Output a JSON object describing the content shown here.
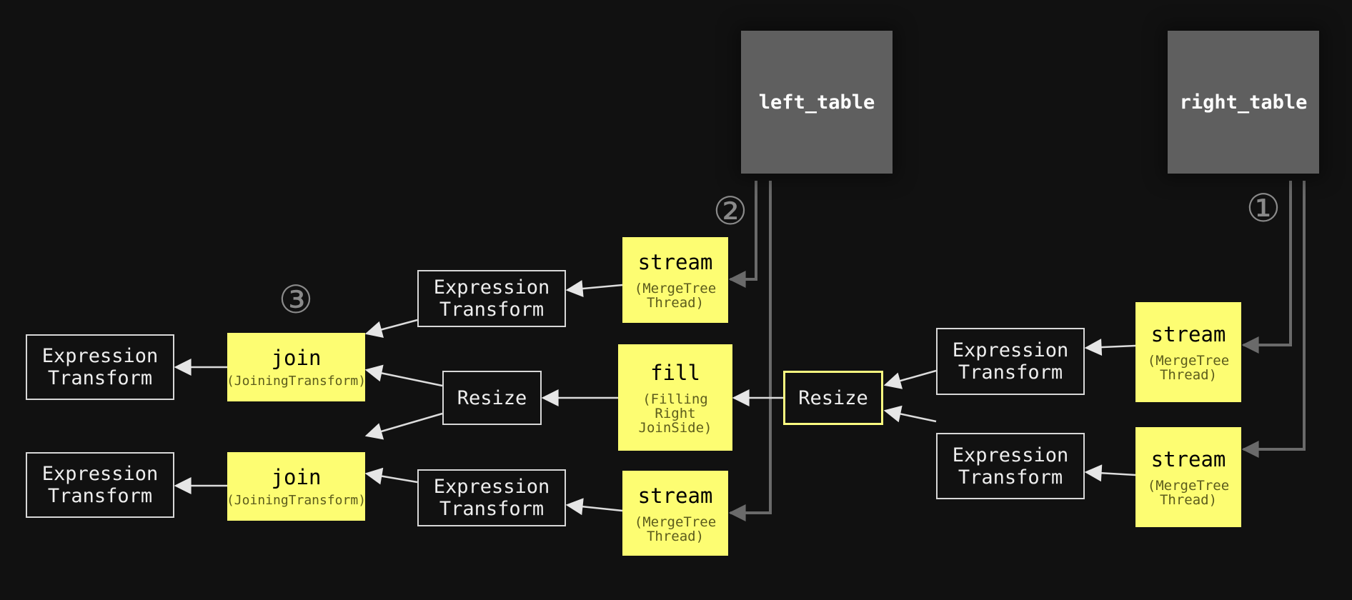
{
  "diagram": {
    "tables": {
      "left": "left_table",
      "right": "right_table"
    },
    "markers": {
      "one": "①",
      "two": "②",
      "three": "③"
    },
    "nodes": {
      "stream_title": "stream",
      "stream_sub": "(MergeTree\nThread)",
      "expression_label": "Expression\nTransform",
      "resize_label": "Resize",
      "fill_title": "fill",
      "fill_sub": "(Filling\nRight\nJoinSide)",
      "join_title": "join",
      "join_sub": "(JoiningTransform)"
    },
    "colors": {
      "background": "#111111",
      "table_fill": "#5f5f5f",
      "highlight_fill": "#fdfd72",
      "highlight_border": "#fcfc80",
      "edge": "#e0e0e0",
      "table_edge": "#6a6a6a"
    },
    "edges": [
      {
        "from": "right_table",
        "to": "right-stream-1"
      },
      {
        "from": "right_table",
        "to": "right-stream-2"
      },
      {
        "from": "right-stream-1",
        "to": "right-expression-1"
      },
      {
        "from": "right-stream-2",
        "to": "right-expression-2"
      },
      {
        "from": "right-expression-1",
        "to": "right-resize"
      },
      {
        "from": "right-expression-2",
        "to": "right-resize"
      },
      {
        "from": "right-resize",
        "to": "fill"
      },
      {
        "from": "left_table",
        "to": "left-stream-1"
      },
      {
        "from": "left_table",
        "to": "left-stream-2"
      },
      {
        "from": "left-stream-1",
        "to": "left-expression-1"
      },
      {
        "from": "left-stream-2",
        "to": "left-expression-2"
      },
      {
        "from": "fill",
        "to": "left-resize"
      },
      {
        "from": "left-expression-1",
        "to": "join-1"
      },
      {
        "from": "left-resize",
        "to": "join-1"
      },
      {
        "from": "left-resize",
        "to": "join-2"
      },
      {
        "from": "left-expression-2",
        "to": "join-2"
      },
      {
        "from": "join-1",
        "to": "output-expression-1"
      },
      {
        "from": "join-2",
        "to": "output-expression-2"
      }
    ]
  }
}
